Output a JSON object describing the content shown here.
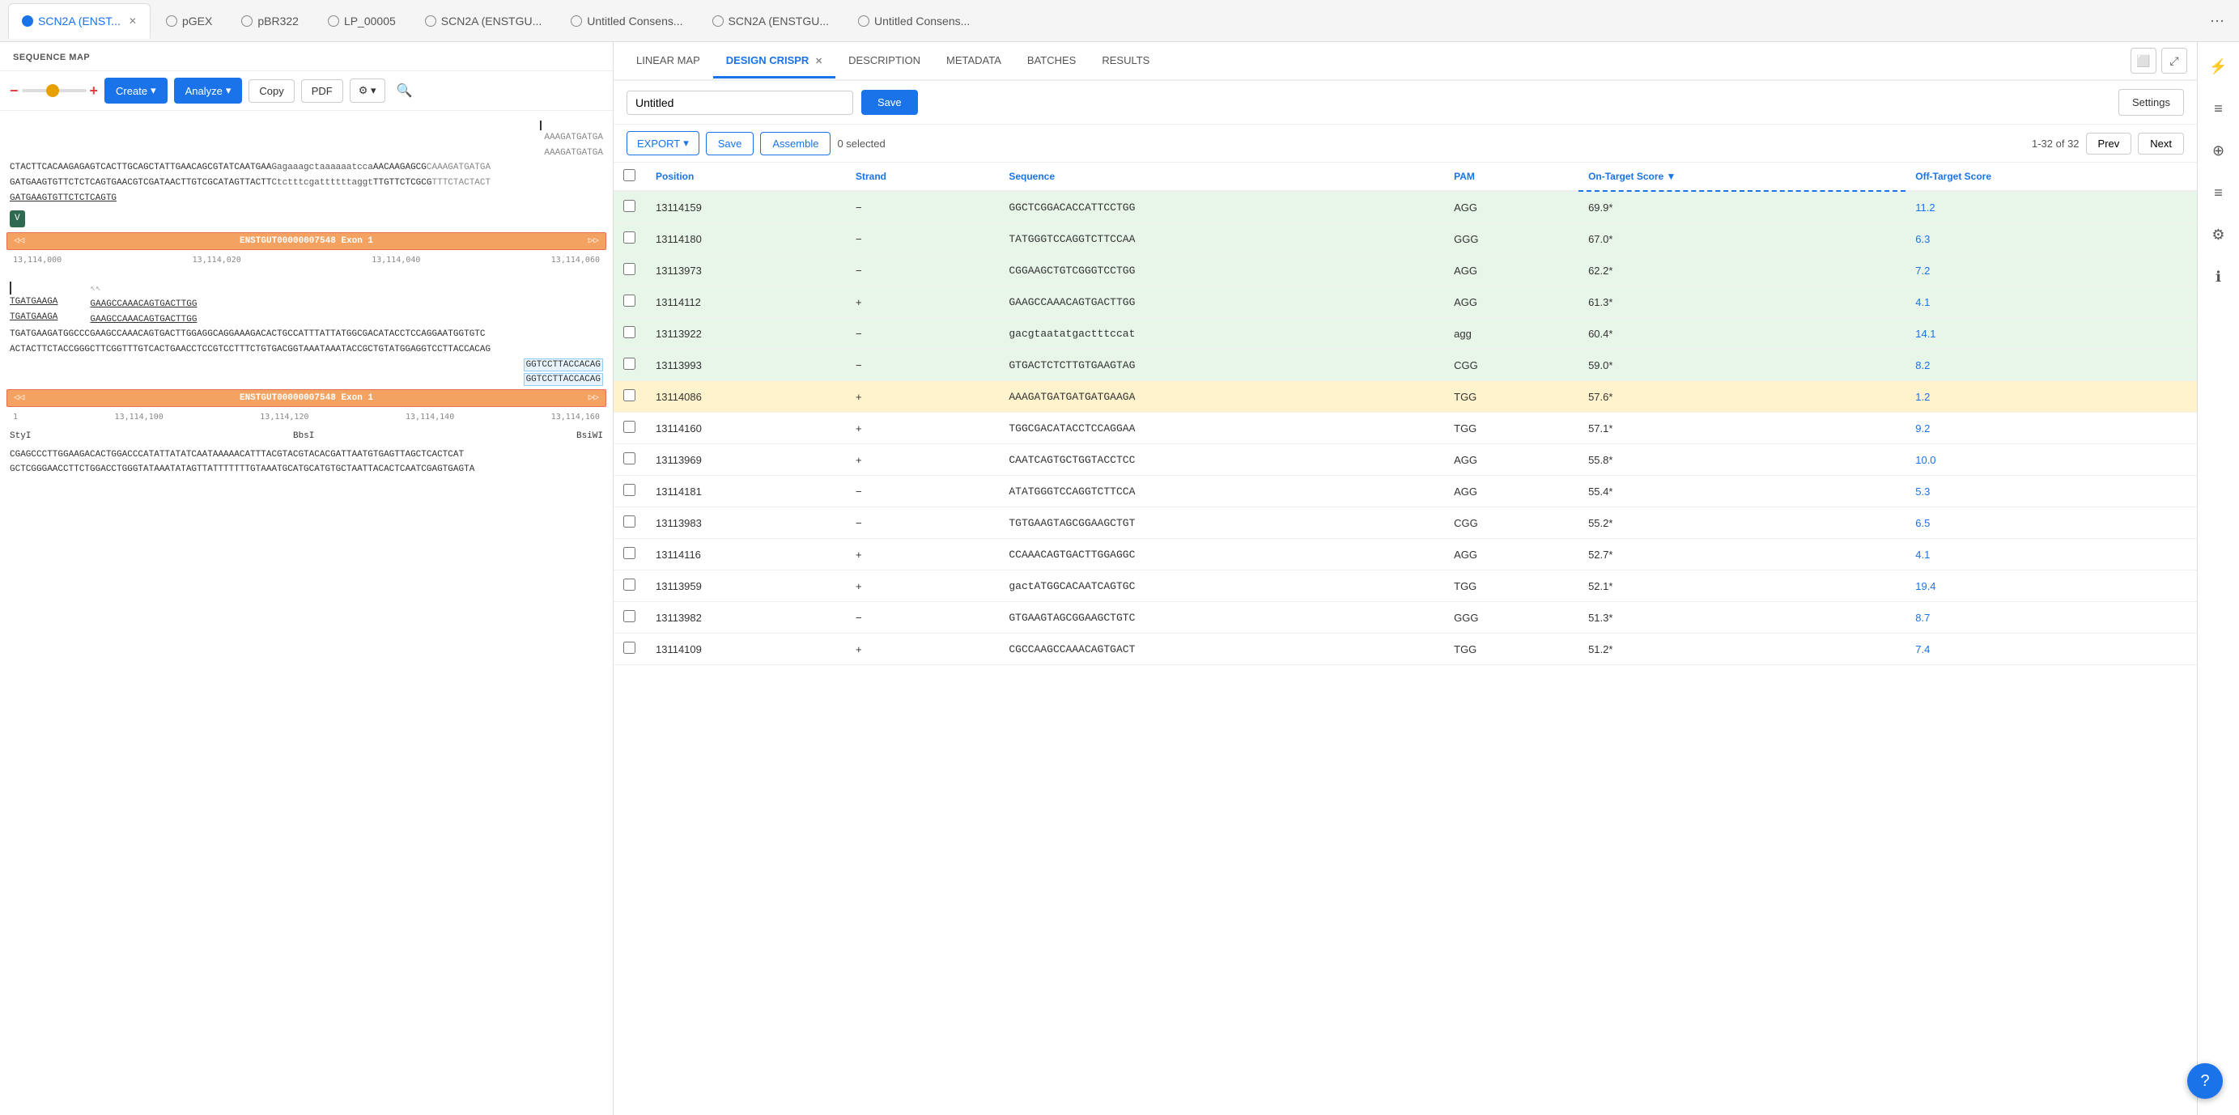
{
  "tabs": [
    {
      "label": "SCN2A (ENST...",
      "active": true,
      "closable": true,
      "icon_active": true
    },
    {
      "label": "pGEX",
      "active": false,
      "closable": false
    },
    {
      "label": "pBR322",
      "active": false,
      "closable": false
    },
    {
      "label": "LP_00005",
      "active": false,
      "closable": false
    },
    {
      "label": "SCN2A (ENSTGU...",
      "active": false,
      "closable": false
    },
    {
      "label": "Untitled Consens...",
      "active": false,
      "closable": false
    },
    {
      "label": "SCN2A (ENSTGU...",
      "active": false,
      "closable": false
    },
    {
      "label": "Untitled Consens...",
      "active": false,
      "closable": false
    }
  ],
  "left_panel": {
    "title": "SEQUENCE MAP",
    "toolbar": {
      "zoom_minus": "−",
      "zoom_plus": "+",
      "create_label": "Create",
      "analyze_label": "Analyze",
      "copy_label": "Copy",
      "pdf_label": "PDF",
      "gear_label": "⚙",
      "search_label": "🔍"
    },
    "sequences": [
      "CTACTTCACAAGAGAGTCACTTGCAGCTATTGAACAGCGTATCAATGAAGAGAAGCTAAAAAATCCAAACAAGAGCGCAAAAGATGATGA",
      "GATGAAGTGTTCTCTCAGTGAACGTCGATAACTTGTCGCATAGTTACTTCTCTTTCGATTTTTTTAGGTTTGTTCTCGCGTTTCTACTACT",
      "GATGAAGTGTTCTCTCAGTG"
    ],
    "label_v": "V",
    "exon_label": "ENSTGUT00000007548 Exon 1",
    "rulers": [
      {
        "marks": [
          "13,114,000",
          "13,114,020",
          "13,114,040",
          "13,114,060"
        ]
      },
      {
        "marks": [
          "13,114,100",
          "13,114,120",
          "13,114,140",
          "13,114,160"
        ]
      }
    ],
    "segment_labels": [
      "StyI",
      "BbsI",
      "BsiWI"
    ],
    "seg_sequences": [
      {
        "top": "GAAGCCAAACAGTGACTTGG",
        "bottom": "GAAGCCAAACAGTGACTTGG"
      },
      {
        "top": "TGATGAAGA",
        "bottom": "TGATGAAGA"
      }
    ],
    "long_seq1": "TGATGAAGATGGCCCGAAGCCAAACAGTGACTTGGAGGCAGGAAAGACACTGCCATTTATTATGGCGACATACCTCCAGGAATGGTGTC",
    "long_seq2": "ACTACTTCTACCGGGCTTCGGTTTGTCACTGAACCTCCGTCCTTTCTGTGACGGTAAATAAATACCGCTGTATGGAGGTCCTTACCACAG",
    "scroll_seq1": "GGTCCTTACCACAG",
    "scroll_seq2": "GGTCCTTACCACAG",
    "bottom_seq1": "CGAGCCCTTGGAAGACACTGGACCCATATTATATCAATAAAAACATTTACGTACGTACACGATTAATGTGAGTTAGCTCACTCAT",
    "bottom_seq2": "GCTCGGGAACCTTCTGGACCTGGGTATAAATATAGTTATTTTTTTGTAAATGCATGCATGTGCTAATTACACTCAATCGAGTGAGTA"
  },
  "right_panel": {
    "tabs": [
      {
        "label": "LINEAR MAP",
        "active": false
      },
      {
        "label": "DESIGN CRISPR",
        "active": true,
        "closable": true
      },
      {
        "label": "DESCRIPTION",
        "active": false
      },
      {
        "label": "METADATA",
        "active": false
      },
      {
        "label": "BATCHES",
        "active": false
      },
      {
        "label": "RESULTS",
        "active": false
      }
    ],
    "name_input": {
      "value": "Untitled",
      "placeholder": "Untitled"
    },
    "save_label": "Save",
    "settings_label": "Settings",
    "export_label": "EXPORT",
    "save_btn_label": "Save",
    "assemble_label": "Assemble",
    "selected_count": "0 selected",
    "pagination": {
      "text": "1-32 of 32",
      "prev": "Prev",
      "next": "Next"
    },
    "table": {
      "headers": [
        "",
        "Position",
        "Strand",
        "Sequence",
        "PAM",
        "On-Target Score ▼",
        "Off-Target Score"
      ],
      "rows": [
        {
          "position": "13114159",
          "strand": "−",
          "sequence": "GGCTCGGACACCATTCCTGG",
          "pam": "AGG",
          "on_target": "69.9*",
          "off_target": "11.2",
          "highlight": "green"
        },
        {
          "position": "13114180",
          "strand": "−",
          "sequence": "TATGGGTCCAGGTCTTCCAA",
          "pam": "GGG",
          "on_target": "67.0*",
          "off_target": "6.3",
          "highlight": "green"
        },
        {
          "position": "13113973",
          "strand": "−",
          "sequence": "CGGAAGCTGTCGGGTCCTGG",
          "pam": "AGG",
          "on_target": "62.2*",
          "off_target": "7.2",
          "highlight": "green"
        },
        {
          "position": "13114112",
          "strand": "+",
          "sequence": "GAAGCCAAACAGTGACTTGG",
          "pam": "AGG",
          "on_target": "61.3*",
          "off_target": "4.1",
          "highlight": "green"
        },
        {
          "position": "13113922",
          "strand": "−",
          "sequence": "gacgtaatatgactttccat",
          "pam": "agg",
          "on_target": "60.4*",
          "off_target": "14.1",
          "highlight": "green"
        },
        {
          "position": "13113993",
          "strand": "−",
          "sequence": "GTGACTCTCTTGTGAAGTAG",
          "pam": "CGG",
          "on_target": "59.0*",
          "off_target": "8.2",
          "highlight": "green"
        },
        {
          "position": "13114086",
          "strand": "+",
          "sequence": "AAAGATGATGATGATGAAGA",
          "pam": "TGG",
          "on_target": "57.6*",
          "off_target": "1.2",
          "highlight": "orange"
        },
        {
          "position": "13114160",
          "strand": "+",
          "sequence": "TGGCGACATACCTCCAGGAA",
          "pam": "TGG",
          "on_target": "57.1*",
          "off_target": "9.2",
          "highlight": "none"
        },
        {
          "position": "13113969",
          "strand": "+",
          "sequence": "CAATCAGTGCTGGTACCTCC",
          "pam": "AGG",
          "on_target": "55.8*",
          "off_target": "10.0",
          "highlight": "none"
        },
        {
          "position": "13114181",
          "strand": "−",
          "sequence": "ATATGGGTCCAGGTCTTCCA",
          "pam": "AGG",
          "on_target": "55.4*",
          "off_target": "5.3",
          "highlight": "none"
        },
        {
          "position": "13113983",
          "strand": "−",
          "sequence": "TGTGAAGTAGCGGAAGCTGT",
          "pam": "CGG",
          "on_target": "55.2*",
          "off_target": "6.5",
          "highlight": "none"
        },
        {
          "position": "13114116",
          "strand": "+",
          "sequence": "CCAAACAGTGACTTGGAGGC",
          "pam": "AGG",
          "on_target": "52.7*",
          "off_target": "4.1",
          "highlight": "none"
        },
        {
          "position": "13113959",
          "strand": "+",
          "sequence": "gactATGGCACAATCAGTGC",
          "pam": "TGG",
          "on_target": "52.1*",
          "off_target": "19.4",
          "highlight": "none"
        },
        {
          "position": "13113982",
          "strand": "−",
          "sequence": "GTGAAGTAGCGGAAGCTGTC",
          "pam": "GGG",
          "on_target": "51.3*",
          "off_target": "8.7",
          "highlight": "none"
        },
        {
          "position": "13114109",
          "strand": "+",
          "sequence": "CGCCAAGCCAAACAGTGACT",
          "pam": "TGG",
          "on_target": "51.2*",
          "off_target": "7.4",
          "highlight": "none"
        }
      ]
    }
  },
  "right_sidebar": {
    "icons": [
      "⚡",
      "≡",
      "⊕",
      "≡",
      "ℹ",
      "⚙",
      "ℹ"
    ]
  }
}
